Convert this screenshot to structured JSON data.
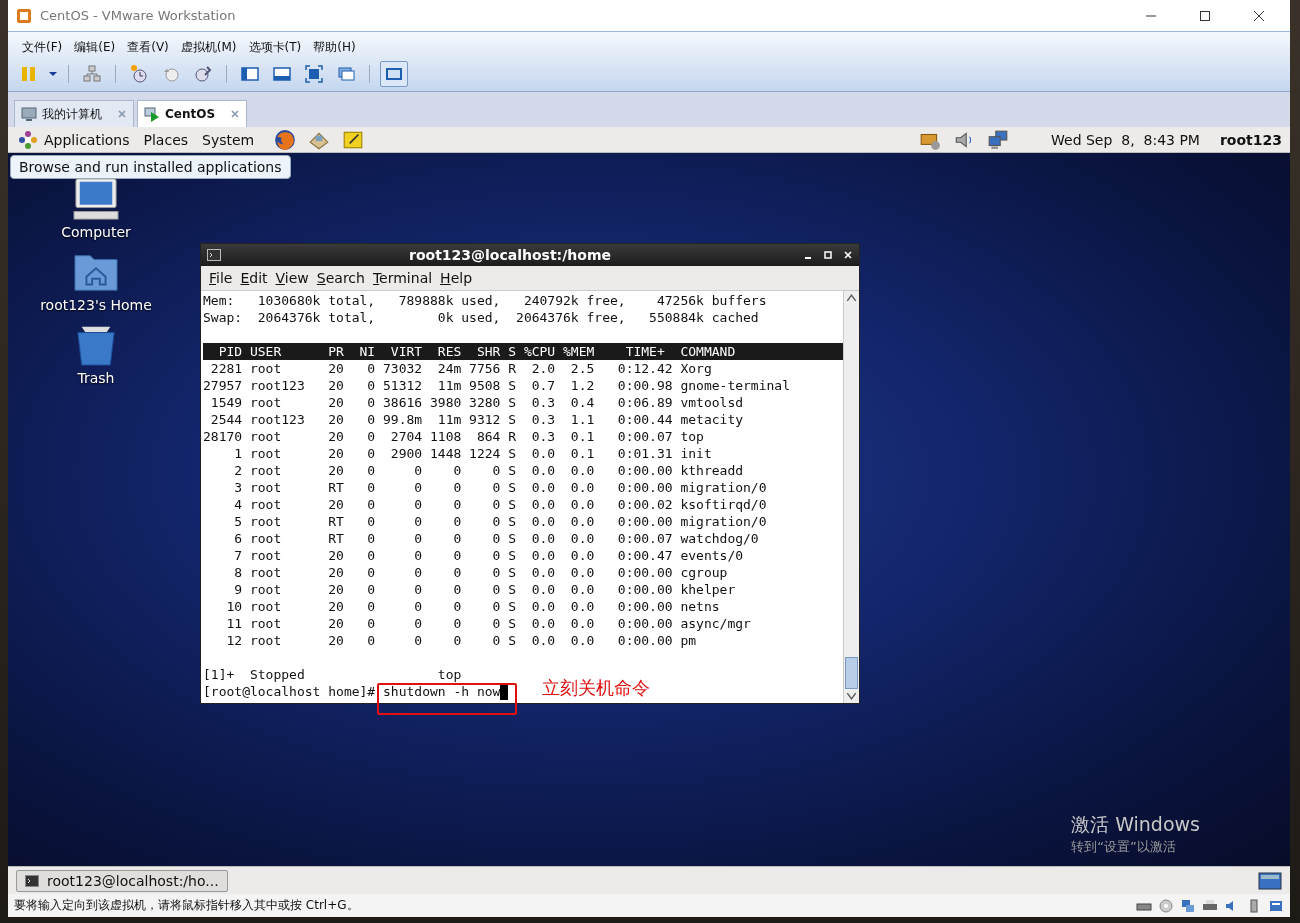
{
  "window": {
    "title": "CentOS - VMware Workstation"
  },
  "menu": [
    "文件(F)",
    "编辑(E)",
    "查看(V)",
    "虚拟机(M)",
    "选项卡(T)",
    "帮助(H)"
  ],
  "tabs": [
    {
      "label": "我的计算机",
      "selected": false
    },
    {
      "label": "CentOS",
      "selected": true
    }
  ],
  "guest": {
    "panel": {
      "menus": [
        "Applications",
        "Places",
        "System"
      ],
      "clock": "Wed Sep  8,  8:43 PM",
      "user": "root123"
    },
    "tooltip": "Browse and run installed applications",
    "desktop_icons": [
      {
        "label": "Computer",
        "kind": "computer"
      },
      {
        "label": "root123's Home",
        "kind": "home"
      },
      {
        "label": "Trash",
        "kind": "trash"
      }
    ],
    "terminal": {
      "title": "root123@localhost:/home",
      "menu": [
        "File",
        "Edit",
        "View",
        "Search",
        "Terminal",
        "Help"
      ],
      "lines": [
        {
          "kind": "text",
          "text": "Mem:   1030680k total,   789888k used,   240792k free,    47256k buffers"
        },
        {
          "kind": "text",
          "text": "Swap:  2064376k total,        0k used,  2064376k free,   550884k cached"
        },
        {
          "kind": "blank"
        },
        {
          "kind": "header",
          "text": "  PID USER      PR  NI  VIRT  RES  SHR S %CPU %MEM    TIME+  COMMAND"
        },
        {
          "kind": "text",
          "text": " 2281 root      20   0 73032  24m 7756 R  2.0  2.5   0:12.42 Xorg"
        },
        {
          "kind": "text",
          "text": "27957 root123   20   0 51312  11m 9508 S  0.7  1.2   0:00.98 gnome-terminal"
        },
        {
          "kind": "text",
          "text": " 1549 root      20   0 38616 3980 3280 S  0.3  0.4   0:06.89 vmtoolsd"
        },
        {
          "kind": "text",
          "text": " 2544 root123   20   0 99.8m  11m 9312 S  0.3  1.1   0:00.44 metacity"
        },
        {
          "kind": "text",
          "text": "28170 root      20   0  2704 1108  864 R  0.3  0.1   0:00.07 top"
        },
        {
          "kind": "text",
          "text": "    1 root      20   0  2900 1448 1224 S  0.0  0.1   0:01.31 init"
        },
        {
          "kind": "text",
          "text": "    2 root      20   0     0    0    0 S  0.0  0.0   0:00.00 kthreadd"
        },
        {
          "kind": "text",
          "text": "    3 root      RT   0     0    0    0 S  0.0  0.0   0:00.00 migration/0"
        },
        {
          "kind": "text",
          "text": "    4 root      20   0     0    0    0 S  0.0  0.0   0:00.02 ksoftirqd/0"
        },
        {
          "kind": "text",
          "text": "    5 root      RT   0     0    0    0 S  0.0  0.0   0:00.00 migration/0"
        },
        {
          "kind": "text",
          "text": "    6 root      RT   0     0    0    0 S  0.0  0.0   0:00.07 watchdog/0"
        },
        {
          "kind": "text",
          "text": "    7 root      20   0     0    0    0 S  0.0  0.0   0:00.47 events/0"
        },
        {
          "kind": "text",
          "text": "    8 root      20   0     0    0    0 S  0.0  0.0   0:00.00 cgroup"
        },
        {
          "kind": "text",
          "text": "    9 root      20   0     0    0    0 S  0.0  0.0   0:00.00 khelper"
        },
        {
          "kind": "text",
          "text": "   10 root      20   0     0    0    0 S  0.0  0.0   0:00.00 netns"
        },
        {
          "kind": "text",
          "text": "   11 root      20   0     0    0    0 S  0.0  0.0   0:00.00 async/mgr"
        },
        {
          "kind": "text",
          "text": "   12 root      20   0     0    0    0 S  0.0  0.0   0:00.00 pm"
        },
        {
          "kind": "blank"
        },
        {
          "kind": "text",
          "text": "[1]+  Stopped                 top"
        },
        {
          "kind": "prompt",
          "text": "[root@localhost home]# shutdown -h now"
        }
      ],
      "annotation": "立刻关机命令"
    },
    "taskbar": [
      {
        "label": "root123@localhost:/ho..."
      }
    ]
  },
  "activation_notice": [
    "激活 Windows",
    "转到“设置”以激活"
  ],
  "status_bar": "要将输入定向到该虚拟机，请将鼠标指针移入其中或按 Ctrl+G。"
}
